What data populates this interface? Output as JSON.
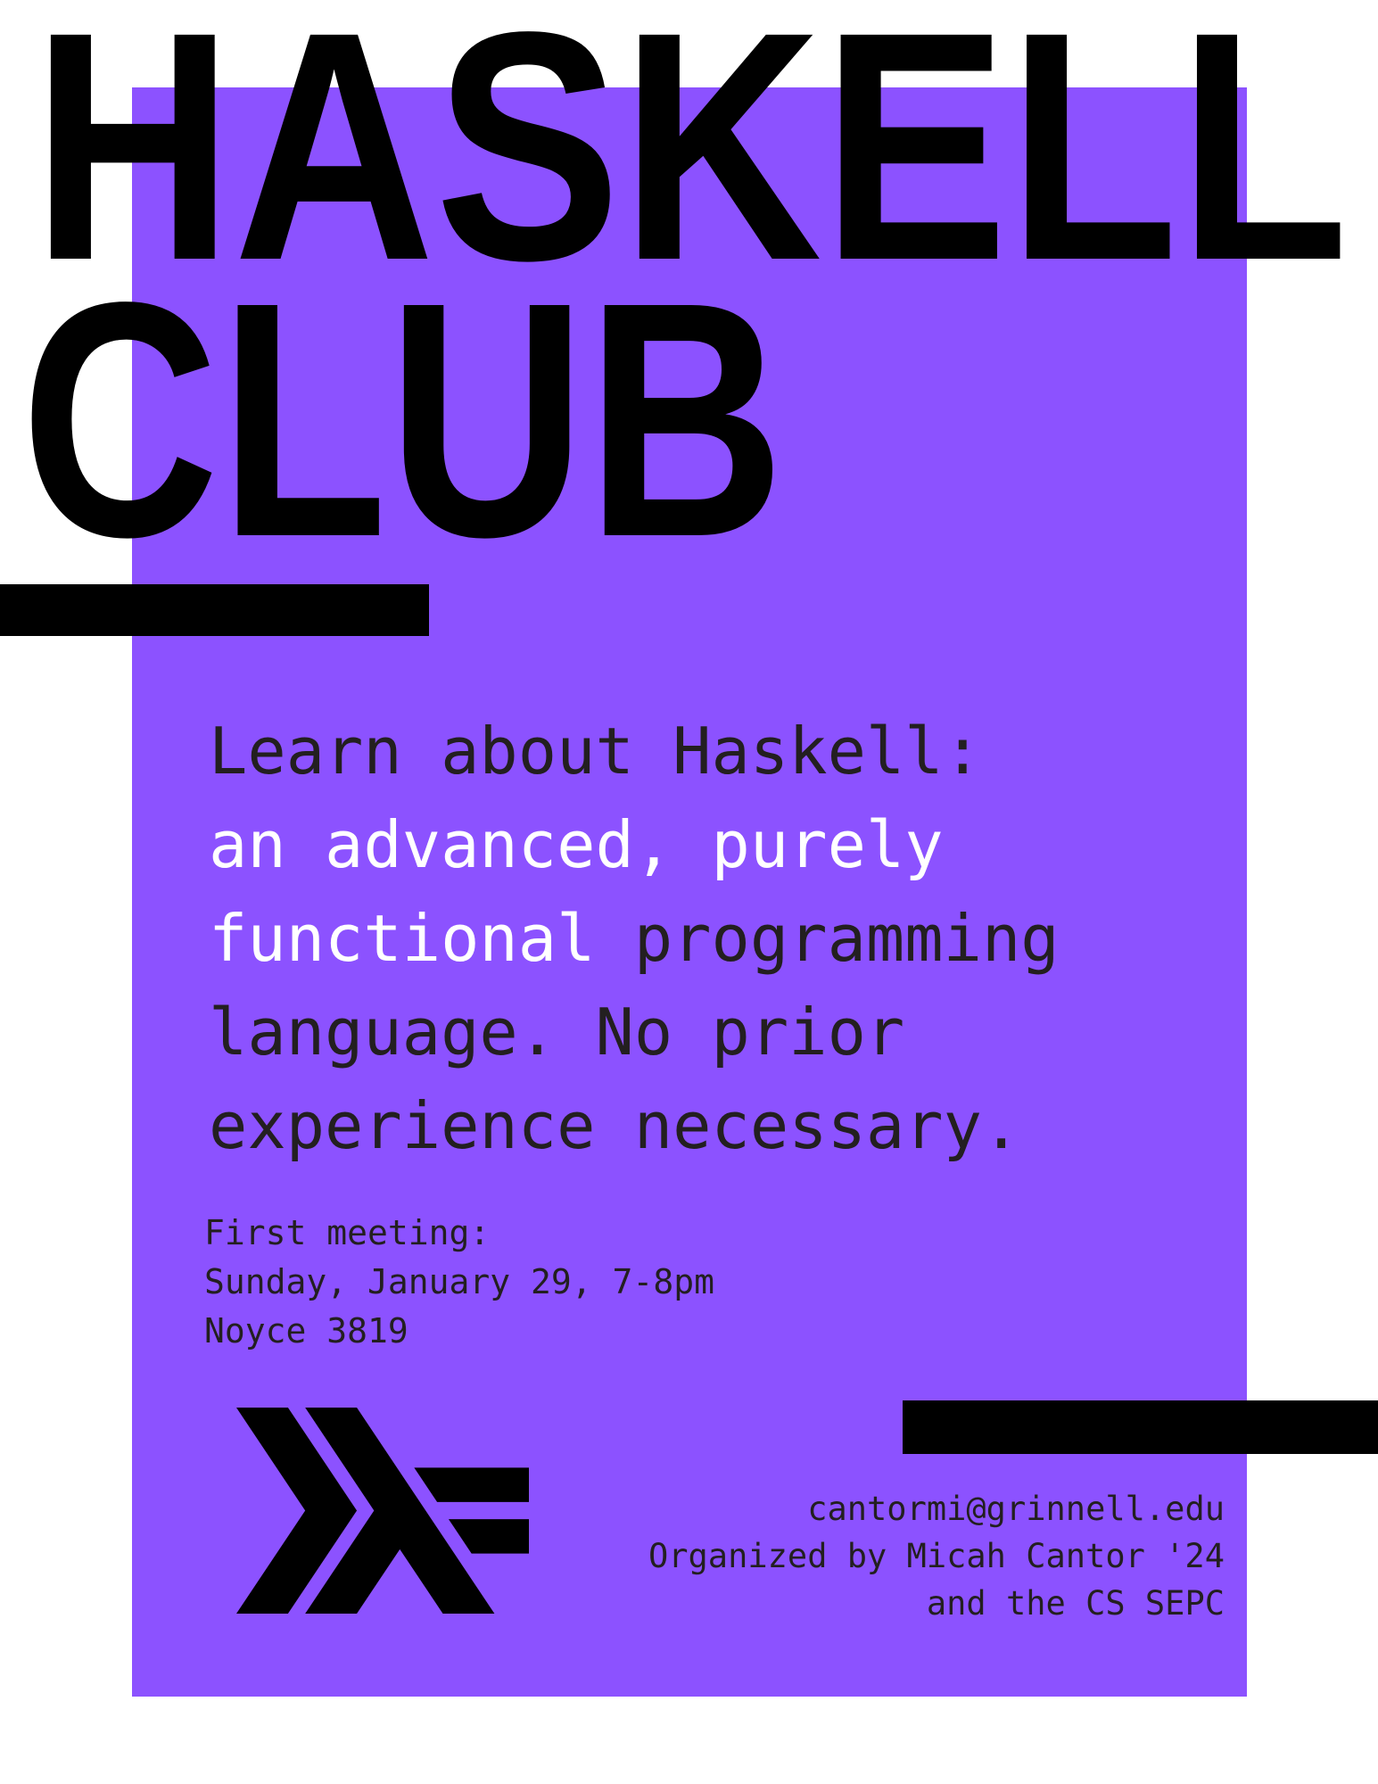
{
  "colors": {
    "accent": "#8c52ff",
    "text_dark": "#231f20",
    "text_light": "#ffffff",
    "black": "#000000"
  },
  "title": {
    "line1": "HASKELL",
    "line2": "CLUB"
  },
  "description": {
    "line1": "Learn about Haskell:",
    "line2": "an advanced, purely",
    "line3a": "functional",
    "line3b": " programming",
    "line4": "language. No prior",
    "line5": "experience necessary."
  },
  "meeting": {
    "label": "First meeting:",
    "datetime": "Sunday, January 29, 7-8pm",
    "location": "Noyce 3819"
  },
  "contact": {
    "email": "cantormi@grinnell.edu",
    "organizer": "Organized by Micah Cantor '24",
    "organizer2": "and the CS SEPC"
  },
  "logo": {
    "icon": "haskell-logo-icon"
  }
}
